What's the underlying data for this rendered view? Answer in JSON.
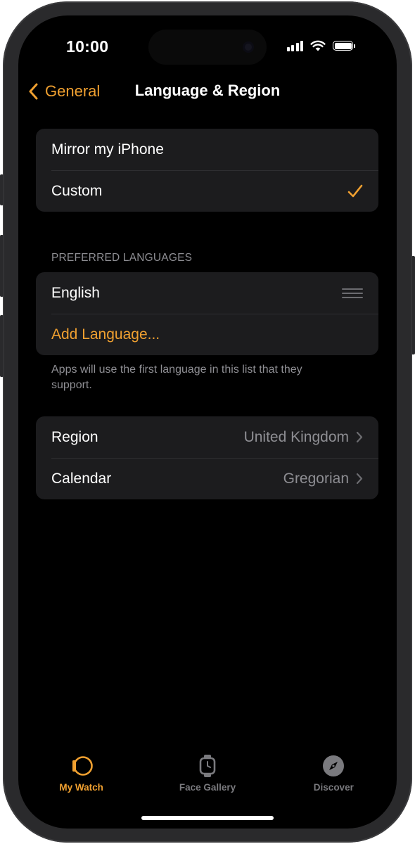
{
  "status_bar": {
    "time": "10:00"
  },
  "nav": {
    "back_label": "General",
    "title": "Language & Region"
  },
  "mode_group": {
    "items": [
      {
        "label": "Mirror my iPhone",
        "selected": false
      },
      {
        "label": "Custom",
        "selected": true
      }
    ]
  },
  "languages": {
    "header": "PREFERRED LANGUAGES",
    "items": [
      {
        "label": "English"
      }
    ],
    "add_label": "Add Language...",
    "footer": "Apps will use the first language in this list that they support."
  },
  "region_group": {
    "region": {
      "label": "Region",
      "value": "United Kingdom"
    },
    "calendar": {
      "label": "Calendar",
      "value": "Gregorian"
    }
  },
  "tabbar": {
    "tabs": [
      {
        "label": "My Watch",
        "icon": "my-watch-icon",
        "active": true
      },
      {
        "label": "Face Gallery",
        "icon": "watch-face-icon",
        "active": false
      },
      {
        "label": "Discover",
        "icon": "compass-icon",
        "active": false
      }
    ]
  },
  "colors": {
    "accent": "#f0a030",
    "background": "#000000",
    "cell": "#1c1c1e",
    "secondary_text": "#8e8e93"
  }
}
